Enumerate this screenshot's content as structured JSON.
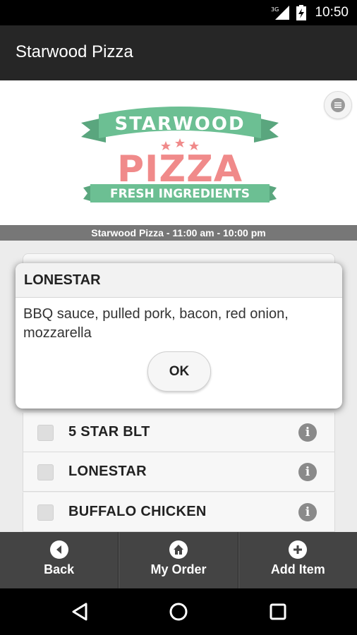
{
  "status_bar": {
    "time": "10:50",
    "network": "3G",
    "signal_icon": "signal-icon",
    "battery_icon": "battery-icon"
  },
  "app_bar": {
    "title": "Starwood Pizza"
  },
  "header": {
    "menu_icon": "menu-icon",
    "logo": {
      "line1": "STARWOOD",
      "line2": "PIZZA",
      "line3": "FRESH INGREDIENTS",
      "colors": {
        "green": "#6cbf93",
        "red": "#f08a8a"
      }
    },
    "hours": "Starwood Pizza - 11:00 am - 10:00 pm"
  },
  "menu_items": [
    {
      "label": "5 STAR BLT",
      "info_icon": "info-icon",
      "checked": false
    },
    {
      "label": "LONESTAR",
      "info_icon": "info-icon",
      "checked": false
    },
    {
      "label": "BUFFALO CHICKEN",
      "info_icon": "info-icon",
      "checked": false
    }
  ],
  "dialog": {
    "title": "LONESTAR",
    "body": "BBQ sauce, pulled pork, bacon, red onion, mozzarella",
    "ok_label": "OK"
  },
  "bottom_nav": [
    {
      "label": "Back",
      "icon": "back-arrow-icon"
    },
    {
      "label": "My Order",
      "icon": "home-icon"
    },
    {
      "label": "Add Item",
      "icon": "plus-icon"
    }
  ],
  "system_nav": {
    "back": "back-triangle-icon",
    "home": "home-circle-icon",
    "recents": "recents-square-icon"
  }
}
